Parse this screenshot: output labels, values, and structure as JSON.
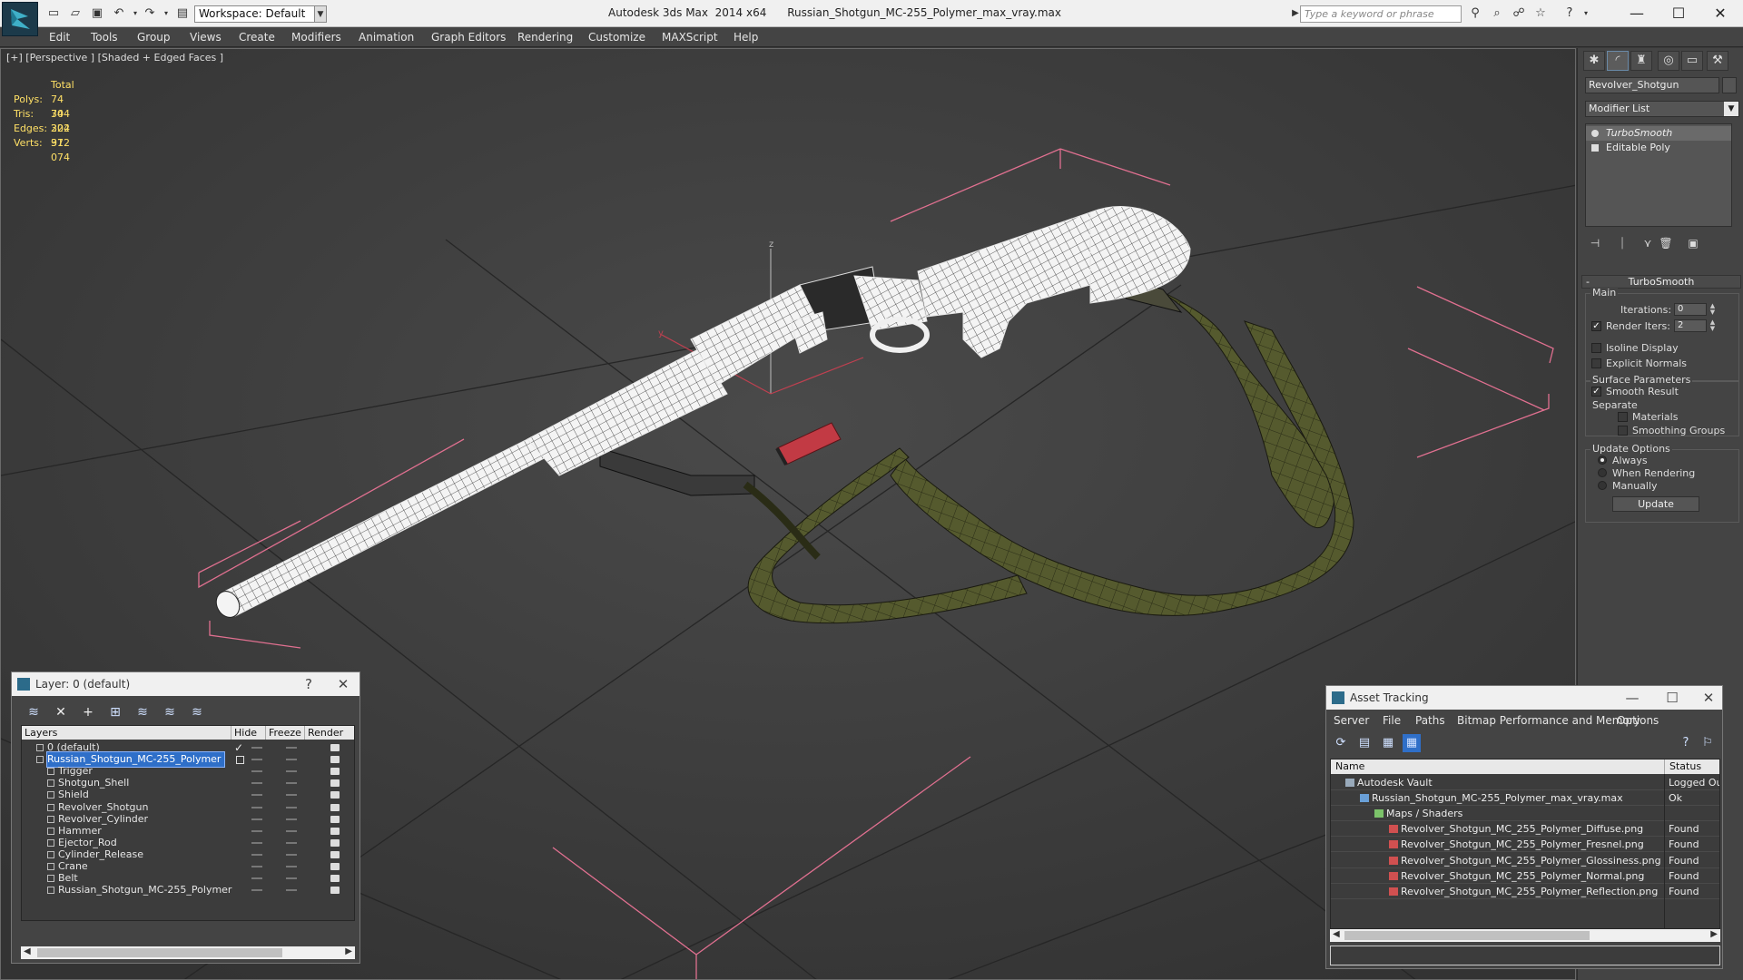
{
  "titlebar": {
    "app_name": "Autodesk 3ds Max  2014 x64",
    "file_name": "Russian_Shotgun_MC-255_Polymer_max_vray.max",
    "workspace": "Workspace: Default",
    "search_placeholder": "Type a keyword or phrase"
  },
  "menu": [
    "Edit",
    "Tools",
    "Group",
    "Views",
    "Create",
    "Modifiers",
    "Animation",
    "Graph Editors",
    "Rendering",
    "Customize",
    "MAXScript",
    "Help"
  ],
  "viewport": {
    "label": "[+] [Perspective ] [Shaded + Edged Faces ]",
    "stats": {
      "header": "Total",
      "rows": [
        {
          "key": "Polys:",
          "value": "74 304"
        },
        {
          "key": "Tris:",
          "value": "74 304"
        },
        {
          "key": "Edges:",
          "value": "222 912"
        },
        {
          "key": "Verts:",
          "value": "37 074"
        }
      ]
    },
    "axis_labels": {
      "z": "z",
      "y": "y"
    }
  },
  "command_panel": {
    "object_name": "Revolver_Shotgun",
    "modifier_list": "Modifier List",
    "stack": [
      "TurboSmooth",
      "Editable Poly"
    ],
    "rollout_title": "TurboSmooth",
    "main_group": "Main",
    "iterations_label": "Iterations:",
    "iterations_value": "0",
    "render_iters_label": "Render Iters:",
    "render_iters_value": "2",
    "render_iters_checked": true,
    "isoline_label": "Isoline Display",
    "explicit_label": "Explicit Normals",
    "surface_group": "Surface Parameters",
    "smooth_result_label": "Smooth Result",
    "separate_label": "Separate",
    "materials_label": "Materials",
    "smoothing_groups_label": "Smoothing Groups",
    "update_group": "Update Options",
    "always_label": "Always",
    "when_rendering_label": "When Rendering",
    "manually_label": "Manually",
    "update_button": "Update"
  },
  "layer_dialog": {
    "title": "Layer: 0 (default)",
    "help": "?",
    "columns": [
      "Layers",
      "Hide",
      "Freeze",
      "Render"
    ],
    "rows": [
      {
        "name": "0 (default)",
        "level": 1,
        "checked": true
      },
      {
        "name": "Russian_Shotgun_MC-255_Polymer",
        "level": 1,
        "selected": true
      },
      {
        "name": "Trigger",
        "level": 2
      },
      {
        "name": "Shotgun_Shell",
        "level": 2
      },
      {
        "name": "Shield",
        "level": 2
      },
      {
        "name": "Revolver_Shotgun",
        "level": 2
      },
      {
        "name": "Revolver_Cylinder",
        "level": 2
      },
      {
        "name": "Hammer",
        "level": 2
      },
      {
        "name": "Ejector_Rod",
        "level": 2
      },
      {
        "name": "Cylinder_Release",
        "level": 2
      },
      {
        "name": "Crane",
        "level": 2
      },
      {
        "name": "Belt",
        "level": 2
      },
      {
        "name": "Russian_Shotgun_MC-255_Polymer",
        "level": 2
      }
    ]
  },
  "asset_dialog": {
    "title": "Asset Tracking",
    "menu": [
      "Server",
      "File",
      "Paths",
      "Bitmap Performance and Memory",
      "Options"
    ],
    "columns": [
      "Name",
      "Status"
    ],
    "rows": [
      {
        "name": "Autodesk Vault",
        "status": "Logged Out",
        "level": 1
      },
      {
        "name": "Russian_Shotgun_MC-255_Polymer_max_vray.max",
        "status": "Ok",
        "level": 2
      },
      {
        "name": "Maps / Shaders",
        "status": "",
        "level": 3
      },
      {
        "name": "Revolver_Shotgun_MC_255_Polymer_Diffuse.png",
        "status": "Found",
        "level": 4
      },
      {
        "name": "Revolver_Shotgun_MC_255_Polymer_Fresnel.png",
        "status": "Found",
        "level": 4
      },
      {
        "name": "Revolver_Shotgun_MC_255_Polymer_Glossiness.png",
        "status": "Found",
        "level": 4
      },
      {
        "name": "Revolver_Shotgun_MC_255_Polymer_Normal.png",
        "status": "Found",
        "level": 4
      },
      {
        "name": "Revolver_Shotgun_MC_255_Polymer_Reflection.png",
        "status": "Found",
        "level": 4
      }
    ]
  },
  "colors": {
    "stats_text": "#ffe066",
    "selection_blue": "#2f6fc8",
    "bounding_box": "#e07090",
    "sling": "#555a2e"
  }
}
